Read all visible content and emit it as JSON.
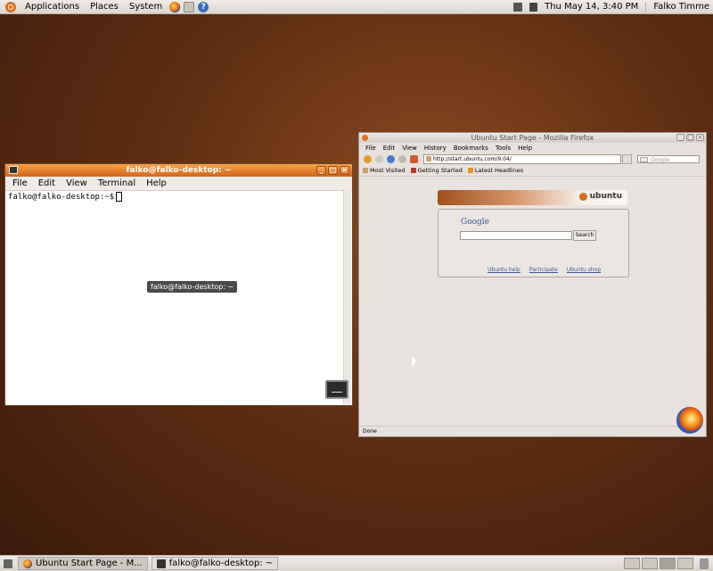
{
  "top_panel": {
    "menus": [
      "Applications",
      "Places",
      "System"
    ],
    "clock": "Thu May 14,  3:40 PM",
    "user": "Falko Timme"
  },
  "terminal": {
    "title": "falko@falko-desktop: ~",
    "menu": [
      "File",
      "Edit",
      "View",
      "Terminal",
      "Help"
    ],
    "prompt": "falko@falko-desktop:~$",
    "tooltip": "falko@falko-desktop: ~"
  },
  "firefox": {
    "title": "Ubuntu Start Page - Mozilla Firefox",
    "menu": [
      "File",
      "Edit",
      "View",
      "History",
      "Bookmarks",
      "Tools",
      "Help"
    ],
    "url": "http://start.ubuntu.com/9.04/",
    "search_placeholder": "Google",
    "bookmarks": [
      "Most Visited",
      "Getting Started",
      "Latest Headlines"
    ],
    "page": {
      "brand": "ubuntu",
      "google_logo": "Google",
      "search_button": "Search",
      "links": [
        "Ubuntu help",
        "Participate",
        "Ubuntu shop"
      ]
    },
    "status": "Done"
  },
  "bottom_panel": {
    "tasks": [
      "Ubuntu Start Page - M...",
      "falko@falko-desktop: ~"
    ]
  }
}
